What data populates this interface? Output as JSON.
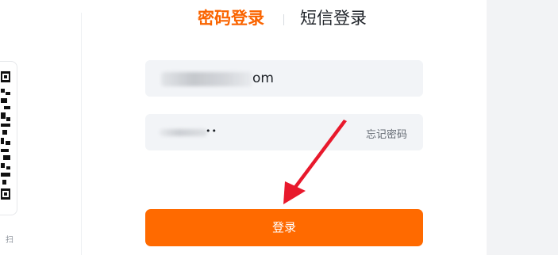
{
  "tabs": {
    "password_login": "密码登录",
    "sms_login": "短信登录",
    "active": "password_login"
  },
  "qr_panel": {
    "hint": "扫"
  },
  "account_field": {
    "visible_suffix": "om"
  },
  "password_field": {
    "masked_tail": "••",
    "forgot_label": "忘记密码"
  },
  "login_button": {
    "label": "登录"
  },
  "annotation": {
    "type": "red-arrow",
    "points_to": "login-button",
    "color": "#e8192c"
  },
  "colors": {
    "accent": "#fa6400",
    "button": "#ff6a00",
    "field_bg": "#f2f4f7"
  }
}
